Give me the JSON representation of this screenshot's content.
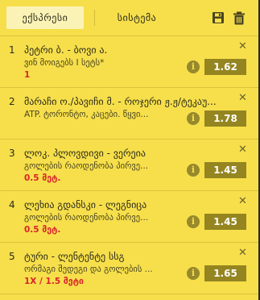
{
  "tabs": [
    {
      "label": "ექსპრესი",
      "active": true
    },
    {
      "label": "სისტემა",
      "active": false
    }
  ],
  "header_icons": [
    "save-icon",
    "trash-icon"
  ],
  "bets": [
    {
      "num": "1",
      "title": "პეტრი ბ. - ბოვი ა.",
      "sub": "ვინ მოიგებს I სეტს*",
      "pick": "1",
      "odds": "1.62"
    },
    {
      "num": "2",
      "title": "მარაჩი ო./პავიჩი მ. - როჯერი ჟ.ჟ/ტეკაუ...",
      "sub": "ATP. ტორონტო, კაცები. წყვი...",
      "pick": "",
      "odds": "1.78"
    },
    {
      "num": "3",
      "title": "ლოკ. პლოვდივი - ვერეია",
      "sub": "გოლების რაოდენობა პირვე...",
      "pick": "0.5 მეტ.",
      "odds": "1.45"
    },
    {
      "num": "4",
      "title": "ლეხია გდანსკი - ლეგნიცა",
      "sub": "გოლების რაოდენობა პირვე...",
      "pick": "0.5 მეტ.",
      "odds": "1.45"
    },
    {
      "num": "5",
      "title": "ტური - ლენტენტე სსგ",
      "sub": "ორმაგი შედეგი და გოლების ...",
      "pick": "1X / 1.5 მეტი",
      "odds": "1.65"
    }
  ],
  "colors": {
    "background": "#f7df4b",
    "odds_badge": "#948520",
    "pick_text": "#d9242b"
  }
}
